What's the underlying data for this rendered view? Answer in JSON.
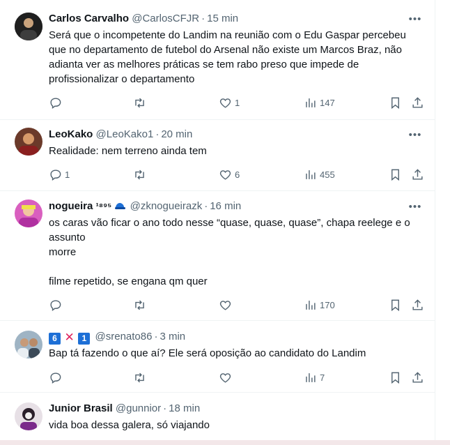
{
  "tweets": [
    {
      "name": "Carlos Carvalho",
      "handle": "@CarlosCFJR",
      "dot": "·",
      "time": "15 min",
      "text": "Será que o incompetente do Landim na reunião com o Edu Gaspar percebeu que no departamento de futebol do Arsenal não existe um Marcos Braz, não adianta ver as melhores práticas se tem rabo preso que impede de profissionalizar o departamento",
      "replies": "",
      "retweets": "",
      "likes": "1",
      "views": "147"
    },
    {
      "name": "LeoKako",
      "handle": "@LeoKako1",
      "dot": "·",
      "time": "20 min",
      "text": "Realidade: nem terreno ainda tem",
      "replies": "1",
      "retweets": "",
      "likes": "6",
      "views": "455"
    },
    {
      "name": "nogueira",
      "name_suffix": "¹⁸⁹⁵",
      "handle": "@zknogueirazk",
      "dot": "·",
      "time": "16 min",
      "text": "os caras vão ficar o ano todo nesse “quase, quase, quase”, chapa reelege e o assunto\nmorre\n\nfilme repetido, se engana qm quer",
      "replies": "",
      "retweets": "",
      "likes": "",
      "views": "170"
    },
    {
      "name": "",
      "badge_6": "6",
      "badge_x": "✕",
      "badge_1": "1",
      "handle": "@srenato86",
      "dot": "·",
      "time": "3 min",
      "text": "Bap tá fazendo o que aí? Ele será oposição ao candidato do Landim",
      "replies": "",
      "retweets": "",
      "likes": "",
      "views": "7"
    },
    {
      "name": "Junior Brasil",
      "handle": "@gunnior",
      "dot": "·",
      "time": "18 min",
      "text": "vida boa dessa galera, só viajando"
    }
  ],
  "icons": {
    "more": "more-horizontal-icon",
    "reply": "reply-icon",
    "retweet": "retweet-icon",
    "like": "heart-icon",
    "views": "views-icon",
    "bookmark": "bookmark-icon",
    "share": "share-icon"
  },
  "colors": {
    "text": "#0f1419",
    "secondary": "#536471",
    "divider": "#eff3f4",
    "badge_blue": "#1d6fd6",
    "badge_red": "#e0245e"
  }
}
